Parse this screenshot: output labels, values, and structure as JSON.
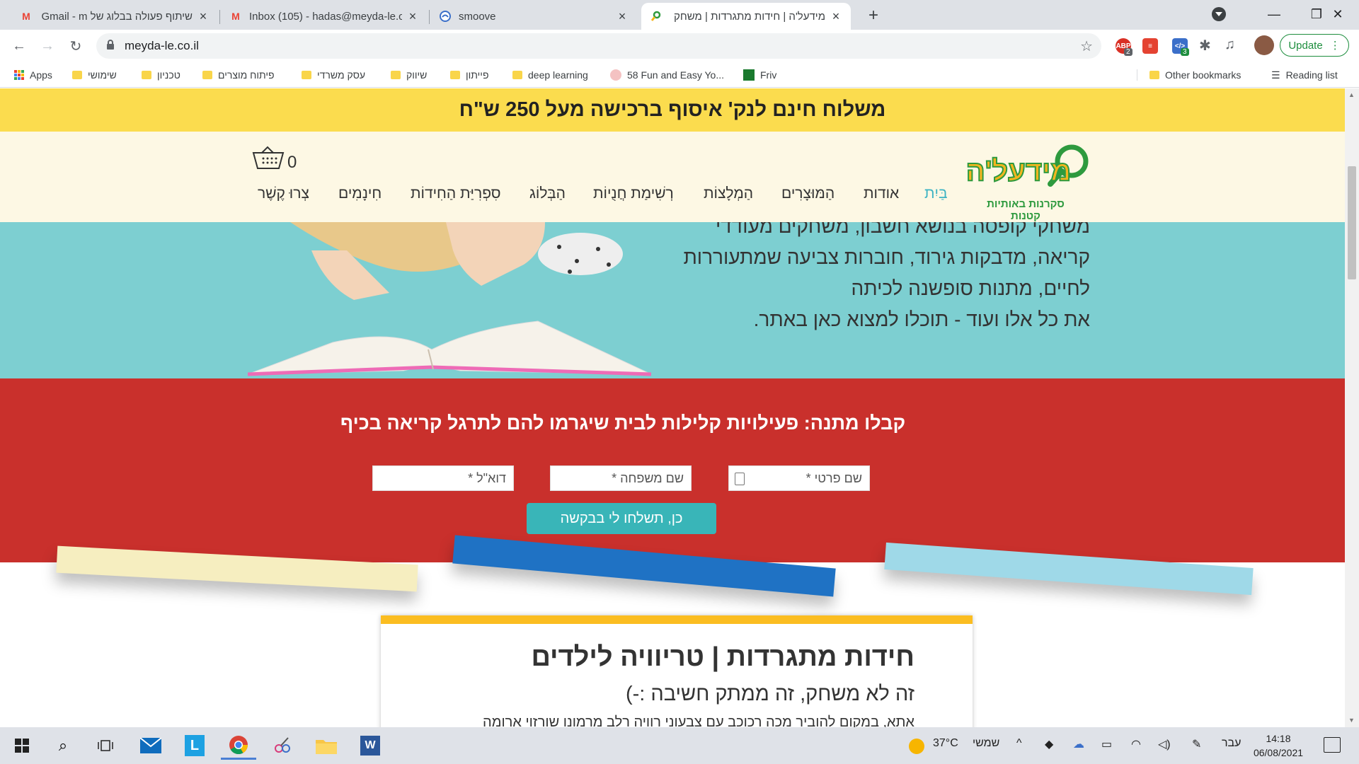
{
  "browser": {
    "tabs": [
      {
        "title": "שיתוף פעולה בבלוג של Gmail - m",
        "icon": "gmail-icon"
      },
      {
        "title": "Inbox (105) - hadas@meyda-le.co",
        "icon": "gmail-icon"
      },
      {
        "title": "smoove",
        "icon": "smoove-icon"
      },
      {
        "title": "מידעל'ה | חידות מתגרדות | משחק",
        "icon": "meyda-icon"
      }
    ],
    "new_tab": "+",
    "url": "meyda-le.co.il",
    "update_label": "Update",
    "extensions": [
      {
        "name": "adblock-icon",
        "label": "ABP",
        "badge": "2",
        "color": "#d93025"
      },
      {
        "name": "todoist-icon",
        "label": "",
        "badge": "",
        "color": "#e44332"
      },
      {
        "name": "devtools-ext-icon",
        "label": "</>",
        "badge": "3",
        "color": "#3b6fc9"
      }
    ]
  },
  "bookmarks": [
    {
      "label": "Apps",
      "type": "apps"
    },
    {
      "label": "שימושי",
      "type": "folder"
    },
    {
      "label": "טכניון",
      "type": "folder"
    },
    {
      "label": "פיתוח מוצרים",
      "type": "folder"
    },
    {
      "label": "עסק משרדי",
      "type": "folder"
    },
    {
      "label": "שיווק",
      "type": "folder"
    },
    {
      "label": "פייתון",
      "type": "folder"
    },
    {
      "label": "deep learning",
      "type": "folder"
    },
    {
      "label": "58 Fun and Easy Yo...",
      "type": "site"
    },
    {
      "label": "Friv",
      "type": "site"
    }
  ],
  "bookmarks_right": {
    "other": "Other bookmarks",
    "reading": "Reading list"
  },
  "site": {
    "promo": "משלוח חינם לנק' איסוף ברכישה מעל 250 ש\"ח",
    "logo_text": "מידעל'ה",
    "logo_tagline": "סקרנות באותיות קטנות",
    "cart_count": "0",
    "nav": [
      {
        "label": "בַּיִת",
        "active": true
      },
      {
        "label": "אודות",
        "active": false
      },
      {
        "label": "הַמּוּצָרִים",
        "active": false
      },
      {
        "label": "הַמְלָצוֹת",
        "active": false
      },
      {
        "label": "רְשִׁימַת חֲנֻיוֹת",
        "active": false
      },
      {
        "label": "הַבְּלוֹג",
        "active": false
      },
      {
        "label": "סִפְרִיַּת הַחִידוֹת",
        "active": false
      },
      {
        "label": "חִינָמִים",
        "active": false
      },
      {
        "label": "צְרוּ קֶשֶׁר",
        "active": false
      }
    ],
    "hero_lines": [
      "משחקי קופסה בנושא חשבון, משחקים מעודדי",
      "קריאה, מדבקות גירוד, חוברות צביעה שמתעוררות",
      "לחיים, מתנות סופשנה לכיתה",
      "את כל אלו ועוד - תוכלו למצוא כאן באתר."
    ],
    "signup": {
      "title": "קבלו מתנה: פעילויות קלילות לבית שיגרמו להם לתרגל קריאה בכיף",
      "first_name": "שם פרטי *",
      "last_name": "שם משפחה *",
      "email": "דוא\"ל *",
      "submit": "כן, תשלחו לי בבקשה"
    },
    "article": {
      "title": "חידות מתגרדות | טריוויה לילדים",
      "subtitle": "זה לא משחק, זה ממתק חשיבה :-)",
      "body": "אתא, במקום להוביר מכה רכוכב עם צבעוני רוויה רלב מרמונו שורזוי ארומה"
    }
  },
  "taskbar": {
    "weather": "37°C",
    "weather_label": "שמשי",
    "lang": "עבר",
    "time": "14:18",
    "date": "06/08/2021"
  }
}
